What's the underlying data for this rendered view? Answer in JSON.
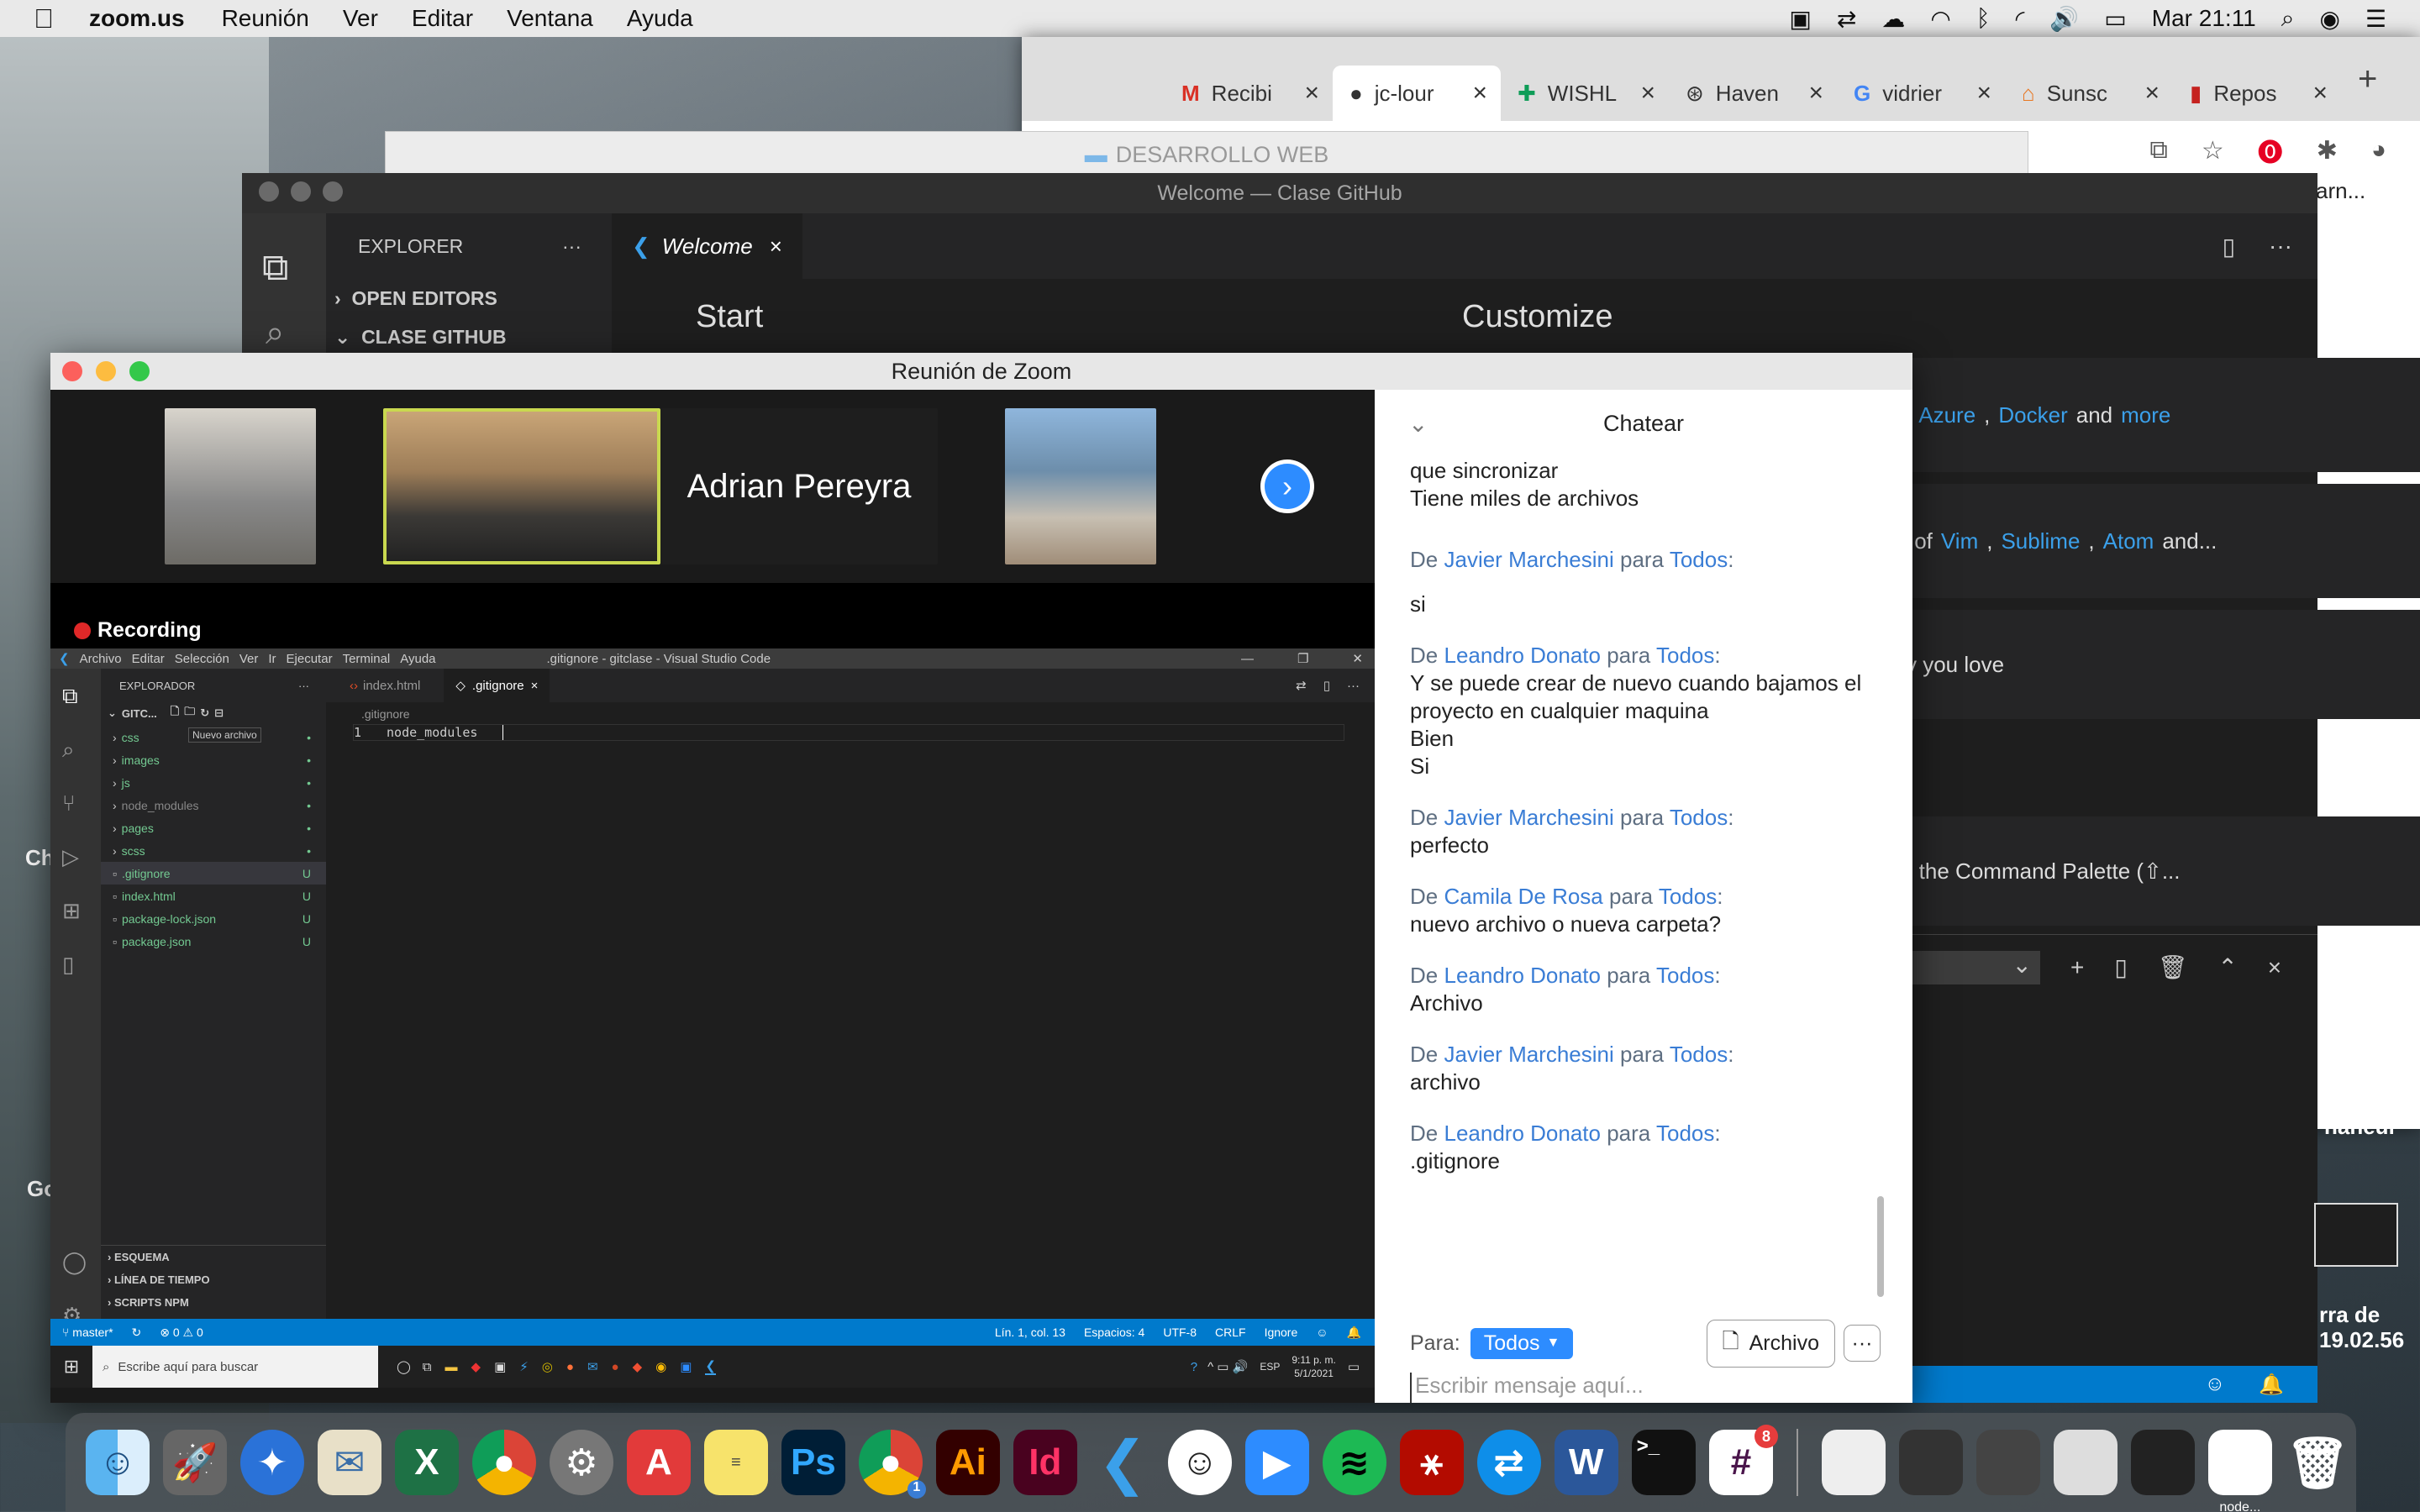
{
  "menubar": {
    "app": "zoom.us",
    "items": [
      "Reunión",
      "Ver",
      "Editar",
      "Ventana",
      "Ayuda"
    ],
    "clock": "Mar 21:11"
  },
  "chrome": {
    "tabs": [
      "Recibi",
      "jc-lour",
      "WISHL",
      "Haven",
      "vidrier",
      "Sunsc",
      "Repos"
    ],
    "tab_colors": [
      "#d93025",
      "#24292e",
      "#0f9d58",
      "#555",
      "#4285f4",
      "#e87722",
      "#c5221f"
    ]
  },
  "finder": {
    "title": "DESARROLLO WEB"
  },
  "vscode": {
    "title": "Welcome — Clase GitHub",
    "explorer_label": "EXPLORER",
    "sections": [
      "OPEN EDITORS",
      "CLASE GITHUB"
    ],
    "tab": "Welcome",
    "start": "Start",
    "customize": "Customize",
    "peek1_pre": ",",
    "peek1_links": [
      "Azure",
      "Docker"
    ],
    "peek1_and": "and",
    "peek1_more": "more",
    "peek2_pre": "s of",
    "peek2_links": [
      "Vim",
      "Sublime",
      "Atom"
    ],
    "peek2_end": "and...",
    "peek3": "y you love",
    "peek4": "n the Command Palette (⇧...",
    "behind_right": [
      "arn...",
      "rra de",
      "19.02.56",
      "Ch",
      "Go",
      "naneur"
    ]
  },
  "zoom": {
    "title": "Reunión de Zoom",
    "speaker": "Adrian Pereyra",
    "recording": "Recording",
    "chat": {
      "title": "Chatear",
      "top_lines": [
        "que sincronizar",
        "Tiene miles de archivos"
      ],
      "from": "De",
      "to": "para",
      "colon": ":",
      "messages": [
        {
          "sender": "Javier Marchesini",
          "target": "Todos",
          "lines": [
            "si"
          ]
        },
        {
          "sender": "Leandro Donato",
          "target": "Todos",
          "lines": [
            "Y se puede crear de nuevo cuando bajamos el proyecto en cualquier maquina",
            "Bien",
            "Si"
          ]
        },
        {
          "sender": "Javier Marchesini",
          "target": "Todos",
          "lines": [
            "perfecto"
          ]
        },
        {
          "sender": "Camila De Rosa",
          "target": "Todos",
          "lines": [
            "nuevo archivo o nueva carpeta?"
          ]
        },
        {
          "sender": "Leandro Donato",
          "target": "Todos",
          "lines": [
            "Archivo"
          ]
        },
        {
          "sender": "Javier Marchesini",
          "target": "Todos",
          "lines": [
            "archivo"
          ]
        },
        {
          "sender": "Leandro Donato",
          "target": "Todos",
          "lines": [
            ".gitignore"
          ]
        }
      ],
      "para": "Para:",
      "to_value": "Todos",
      "file_btn": "Archivo",
      "placeholder": "Escribir mensaje aquí..."
    }
  },
  "shared": {
    "menu": [
      "Archivo",
      "Editar",
      "Selección",
      "Ver",
      "Ir",
      "Ejecutar",
      "Terminal",
      "Ayuda"
    ],
    "title": ".gitignore - gitclase - Visual Studio Code",
    "explorer": "EXPLORADOR",
    "folder": "GITC...",
    "tooltip": "Nuevo archivo",
    "tree": [
      {
        "name": "css",
        "dir": true
      },
      {
        "name": "images",
        "dir": true
      },
      {
        "name": "js",
        "dir": true
      },
      {
        "name": "node_modules",
        "dir": true
      },
      {
        "name": "pages",
        "dir": true
      },
      {
        "name": "scss",
        "dir": true
      },
      {
        "name": ".gitignore",
        "dir": false,
        "badge": "U"
      },
      {
        "name": "index.html",
        "dir": false,
        "badge": "U"
      },
      {
        "name": "package-lock.json",
        "dir": false,
        "badge": "U"
      },
      {
        "name": "package.json",
        "dir": false,
        "badge": "U"
      }
    ],
    "tabs": [
      "index.html",
      ".gitignore"
    ],
    "breadcrumb": ".gitignore",
    "line_no": "1",
    "code": "node_modules",
    "bottom": [
      "ESQUEMA",
      "LÍNEA DE TIEMPO",
      "SCRIPTS NPM"
    ],
    "status_left": [
      "master*",
      "⊗ 0 ⚠ 0"
    ],
    "status_right": [
      "Lín. 1, col. 13",
      "Espacios: 4",
      "UTF-8",
      "CRLF",
      "Ignore"
    ],
    "search": "Escribe aquí para buscar",
    "lang": "ESP",
    "clock": "9:11 p. m.",
    "date": "5/1/2021"
  },
  "dock": {
    "badge_slack": "8",
    "badge_chrome": "1",
    "last_label": "node..."
  }
}
